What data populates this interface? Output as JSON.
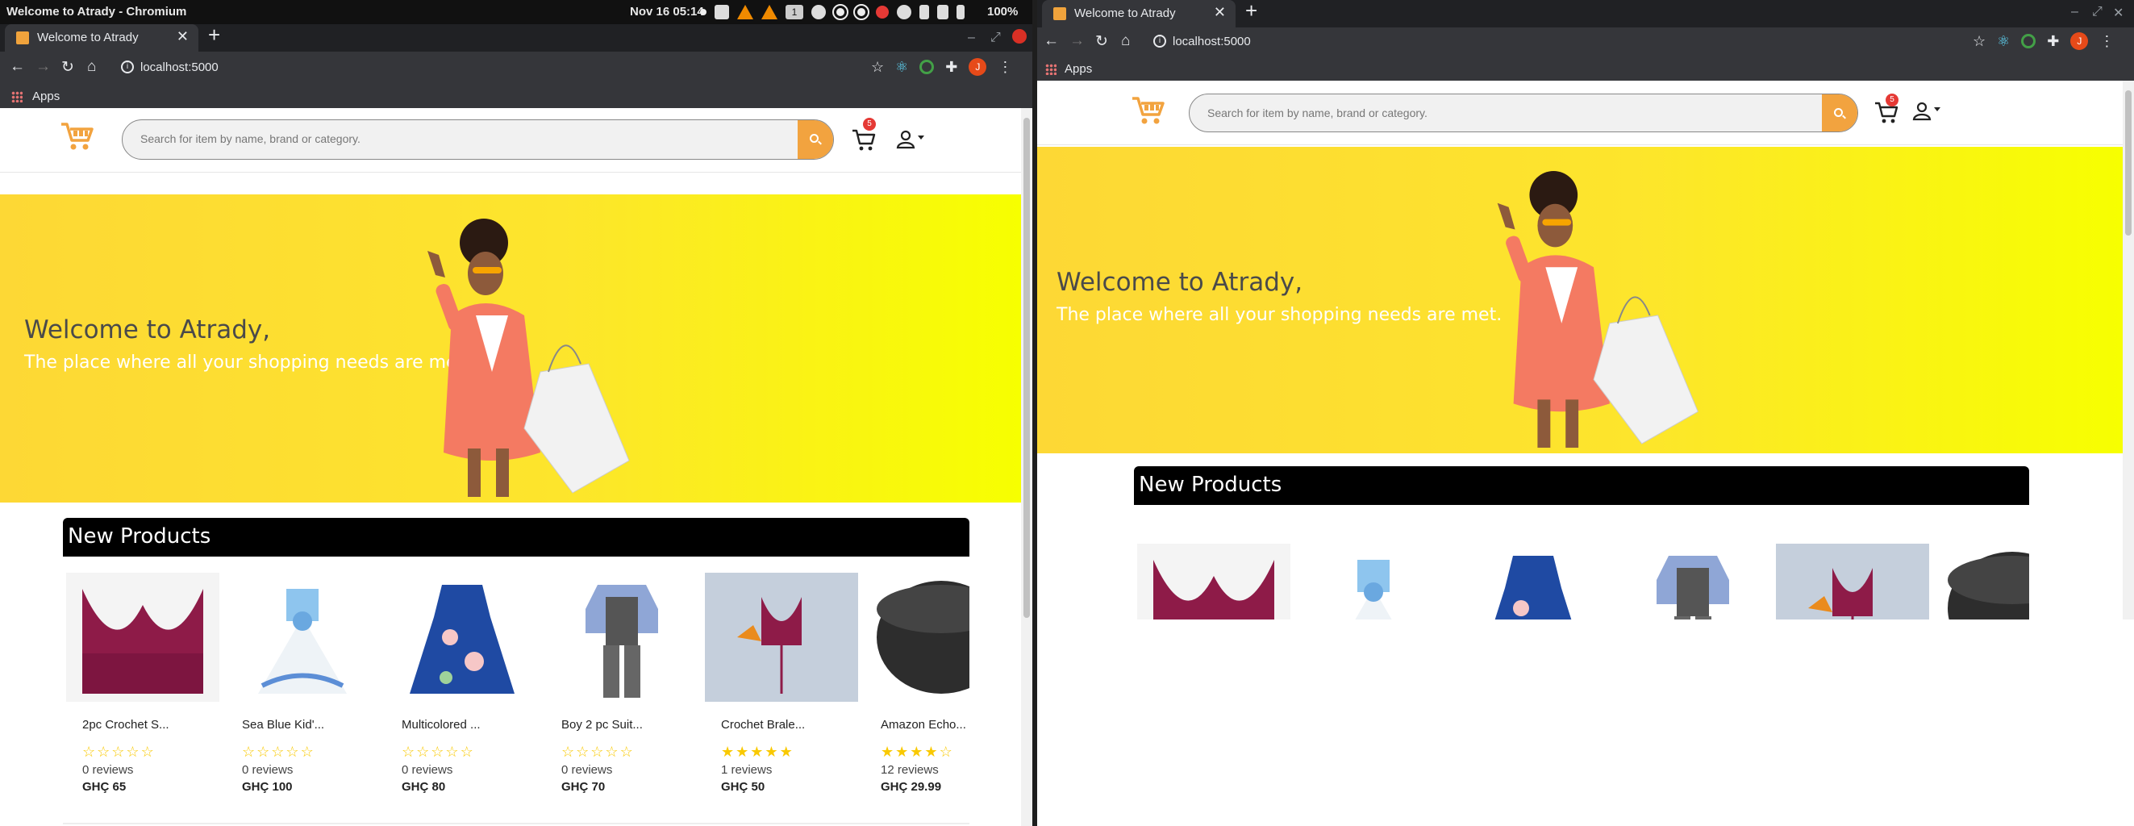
{
  "system": {
    "window_title": "Welcome to Atrady - Chromium",
    "clock": "Nov 16  05:14",
    "workspace": "1",
    "battery": "100%"
  },
  "browser": {
    "tab_title": "Welcome to Atrady",
    "url": "localhost:5000",
    "bookmarks_label": "Apps",
    "avatar_letter": "J"
  },
  "site": {
    "search_placeholder": "Search for item by name, brand or category.",
    "cart_count": "5",
    "hero_title": "Welcome to Atrady,",
    "hero_subtitle": "The place where all your shopping needs are met.",
    "section_title": "New Products"
  },
  "products": [
    {
      "name": "2pc Crochet S...",
      "rating": 0,
      "reviews": "0 reviews",
      "price": "GHÇ 65"
    },
    {
      "name": "Sea Blue Kid'...",
      "rating": 0,
      "reviews": "0 reviews",
      "price": "GHÇ 100"
    },
    {
      "name": "Multicolored ...",
      "rating": 0,
      "reviews": "0 reviews",
      "price": "GHÇ 80"
    },
    {
      "name": "Boy 2 pc Suit...",
      "rating": 0,
      "reviews": "0 reviews",
      "price": "GHÇ 70"
    },
    {
      "name": "Crochet Brale...",
      "rating": 5,
      "reviews": "1 reviews",
      "price": "GHÇ 50"
    },
    {
      "name": "Amazon Echo...",
      "rating": 4,
      "reviews": "12 reviews",
      "price": "GHÇ 29.99"
    }
  ],
  "colors": {
    "accent": "#f2a33f",
    "hero_yellow": "#fde52c",
    "badge_red": "#e53935",
    "star": "#f9c900"
  }
}
